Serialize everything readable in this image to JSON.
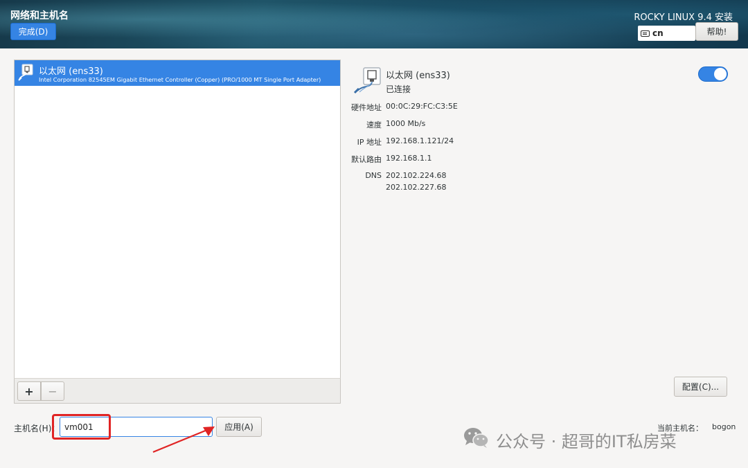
{
  "header": {
    "title": "网络和主机名",
    "done_label": "完成(D)",
    "product": "ROCKY LINUX 9.4 安装",
    "keyboard_layout": "cn",
    "help_label": "帮助!"
  },
  "device_list": {
    "items": [
      {
        "name": "以太网 (ens33)",
        "description": "Intel Corporation 82545EM Gigabit Ethernet Controller (Copper) (PRO/1000 MT Single Port Adapter)",
        "icon": "ethernet-icon",
        "selected": true
      }
    ],
    "add_label": "+",
    "remove_label": "−"
  },
  "details": {
    "name": "以太网 (ens33)",
    "status": "已连接",
    "enabled": true,
    "hardware_label": "硬件地址",
    "hardware_value": "00:0C:29:FC:C3:5E",
    "speed_label": "速度",
    "speed_value": "1000 Mb/s",
    "ip_label": "IP 地址",
    "ip_value": "192.168.1.121/24",
    "route_label": "默认路由",
    "route_value": "192.168.1.1",
    "dns_label": "DNS",
    "dns_values": [
      "202.102.224.68",
      "202.102.227.68"
    ],
    "config_label": "配置(C)..."
  },
  "hostname": {
    "label": "主机名(H)：",
    "value": "vm001",
    "apply_label": "应用(A)",
    "current_label": "当前主机名：",
    "current_value": "bogon"
  },
  "watermark": {
    "text": "公众号 · 超哥的IT私房菜"
  },
  "colors": {
    "accent": "#3584e4",
    "highlight": "#e02424",
    "background": "#f6f5f4"
  }
}
